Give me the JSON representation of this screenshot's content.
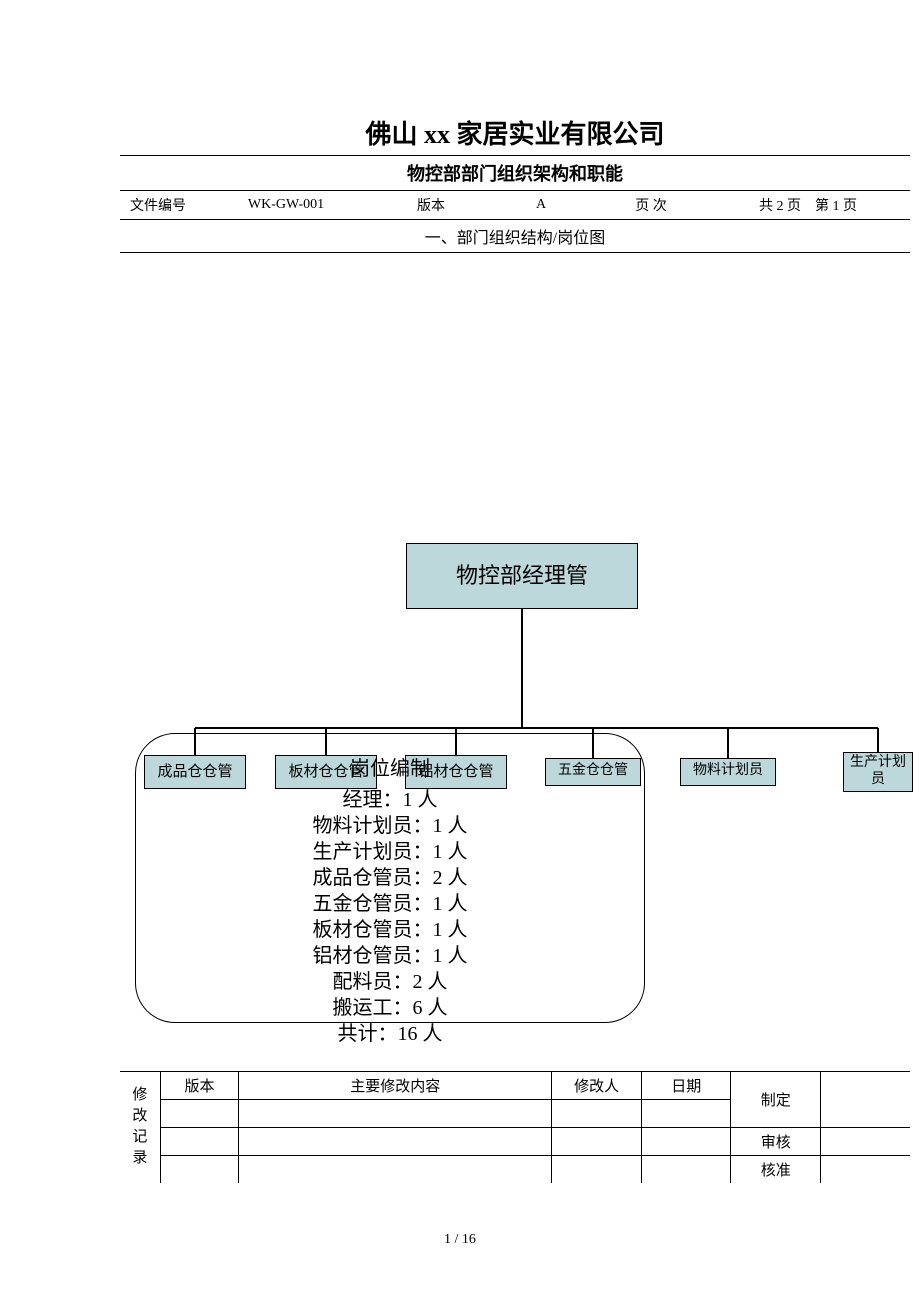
{
  "header": {
    "company": "佛山 xx 家居实业有限公司",
    "subtitle": "物控部部门组织架构和职能",
    "meta": {
      "doc_no_label": "文件编号",
      "doc_no": "WK-GW-001",
      "version_label": "版本",
      "version": "A",
      "page_label": "页 次",
      "page_info": "共 2 页　第 1 页"
    },
    "section": "一、部门组织结构/岗位图"
  },
  "org": {
    "root": "物控部经理管",
    "children": [
      "成品仓仓管",
      "板材仓仓管",
      "铝材仓仓管",
      "五金仓仓管",
      "物料计划员",
      "生产计划员"
    ]
  },
  "staffing": {
    "title": "岗位编制",
    "lines": [
      "经理：1 人",
      "物料计划员：1 人",
      "生产计划员：1 人",
      "成品仓管员：2 人",
      "五金仓管员：1 人",
      "板材仓管员：1 人",
      "铝材仓管员：1 人",
      "配料员：2 人",
      "搬运工：6 人",
      "共计：16 人"
    ]
  },
  "footer": {
    "row_label": "修改记录",
    "cols": {
      "version": "版本",
      "content": "主要修改内容",
      "modifier": "修改人",
      "date": "日期",
      "approve1": "制定",
      "approve2": "审核",
      "approve3": "核准"
    }
  },
  "page_num": "1 / 16"
}
